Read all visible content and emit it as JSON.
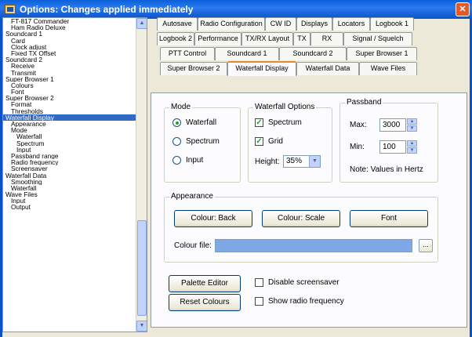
{
  "window": {
    "title": "Options: Changes applied immediately"
  },
  "tree": {
    "items": [
      {
        "label": "FT-817 Commander",
        "level": 1
      },
      {
        "label": "Ham Radio Deluxe",
        "level": 1
      },
      {
        "label": "Soundcard 1",
        "level": 0
      },
      {
        "label": "Card",
        "level": 1
      },
      {
        "label": "Clock adjust",
        "level": 1
      },
      {
        "label": "Fixed TX Offset",
        "level": 1
      },
      {
        "label": "Soundcard 2",
        "level": 0
      },
      {
        "label": "Receive",
        "level": 1
      },
      {
        "label": "Transmit",
        "level": 1
      },
      {
        "label": "Super Browser 1",
        "level": 0
      },
      {
        "label": "Colours",
        "level": 1
      },
      {
        "label": "Font",
        "level": 1
      },
      {
        "label": "Super Browser 2",
        "level": 0
      },
      {
        "label": "Format",
        "level": 1
      },
      {
        "label": "Thresholds",
        "level": 1
      },
      {
        "label": "Waterfall Display",
        "level": 0,
        "selected": true
      },
      {
        "label": "Appearance",
        "level": 1
      },
      {
        "label": "Mode",
        "level": 1
      },
      {
        "label": "Waterfall",
        "level": 2
      },
      {
        "label": "Spectrum",
        "level": 2
      },
      {
        "label": "Input",
        "level": 2
      },
      {
        "label": "Passband range",
        "level": 1
      },
      {
        "label": "Radio frequency",
        "level": 1
      },
      {
        "label": "Screensaver",
        "level": 1
      },
      {
        "label": "Waterfall Data",
        "level": 0
      },
      {
        "label": "Smoothing",
        "level": 1
      },
      {
        "label": "Waterfall",
        "level": 1
      },
      {
        "label": "Wave Files",
        "level": 0
      },
      {
        "label": "Input",
        "level": 1
      },
      {
        "label": "Output",
        "level": 1
      }
    ]
  },
  "tabs": {
    "row1": [
      "Autosave",
      "Radio Configuration",
      "CW ID",
      "Displays",
      "Locators",
      "Logbook 1"
    ],
    "row2": [
      "Logbook 2",
      "Performance",
      "TX/RX Layout",
      "TX",
      "RX",
      "Signal / Squelch"
    ],
    "row3": [
      "PTT Control",
      "Soundcard 1",
      "Soundcard 2",
      "Super Browser 1"
    ],
    "row4": [
      "Super Browser 2",
      "Waterfall Display",
      "Waterfall Data",
      "Wave Files"
    ],
    "active": "Waterfall Display"
  },
  "mode": {
    "title": "Mode",
    "options": [
      "Waterfall",
      "Spectrum",
      "Input"
    ],
    "selected": "Waterfall"
  },
  "waterfall_options": {
    "title": "Waterfall Options",
    "spectrum_label": "Spectrum",
    "spectrum_checked": true,
    "grid_label": "Grid",
    "grid_checked": true,
    "height_label": "Height:",
    "height_value": "35%"
  },
  "passband": {
    "title": "Passband",
    "max_label": "Max:",
    "max_value": "3000",
    "min_label": "Min:",
    "min_value": "100",
    "note": "Note: Values in Hertz"
  },
  "appearance": {
    "title": "Appearance",
    "colour_back": "Colour: Back",
    "colour_scale": "Colour: Scale",
    "font": "Font",
    "colour_file_label": "Colour file:",
    "colour_file_value": "",
    "browse": "..."
  },
  "bottom": {
    "palette_editor": "Palette Editor",
    "reset_colours": "Reset Colours",
    "disable_screensaver": "Disable screensaver",
    "disable_screensaver_checked": false,
    "show_radio_frequency": "Show radio frequency",
    "show_radio_frequency_checked": false
  },
  "colors": {
    "title_bar": "#0b52c8",
    "selection": "#316ac5",
    "active_tab_accent": "#e68b2c",
    "colour_file_field": "#7fa9e6"
  }
}
